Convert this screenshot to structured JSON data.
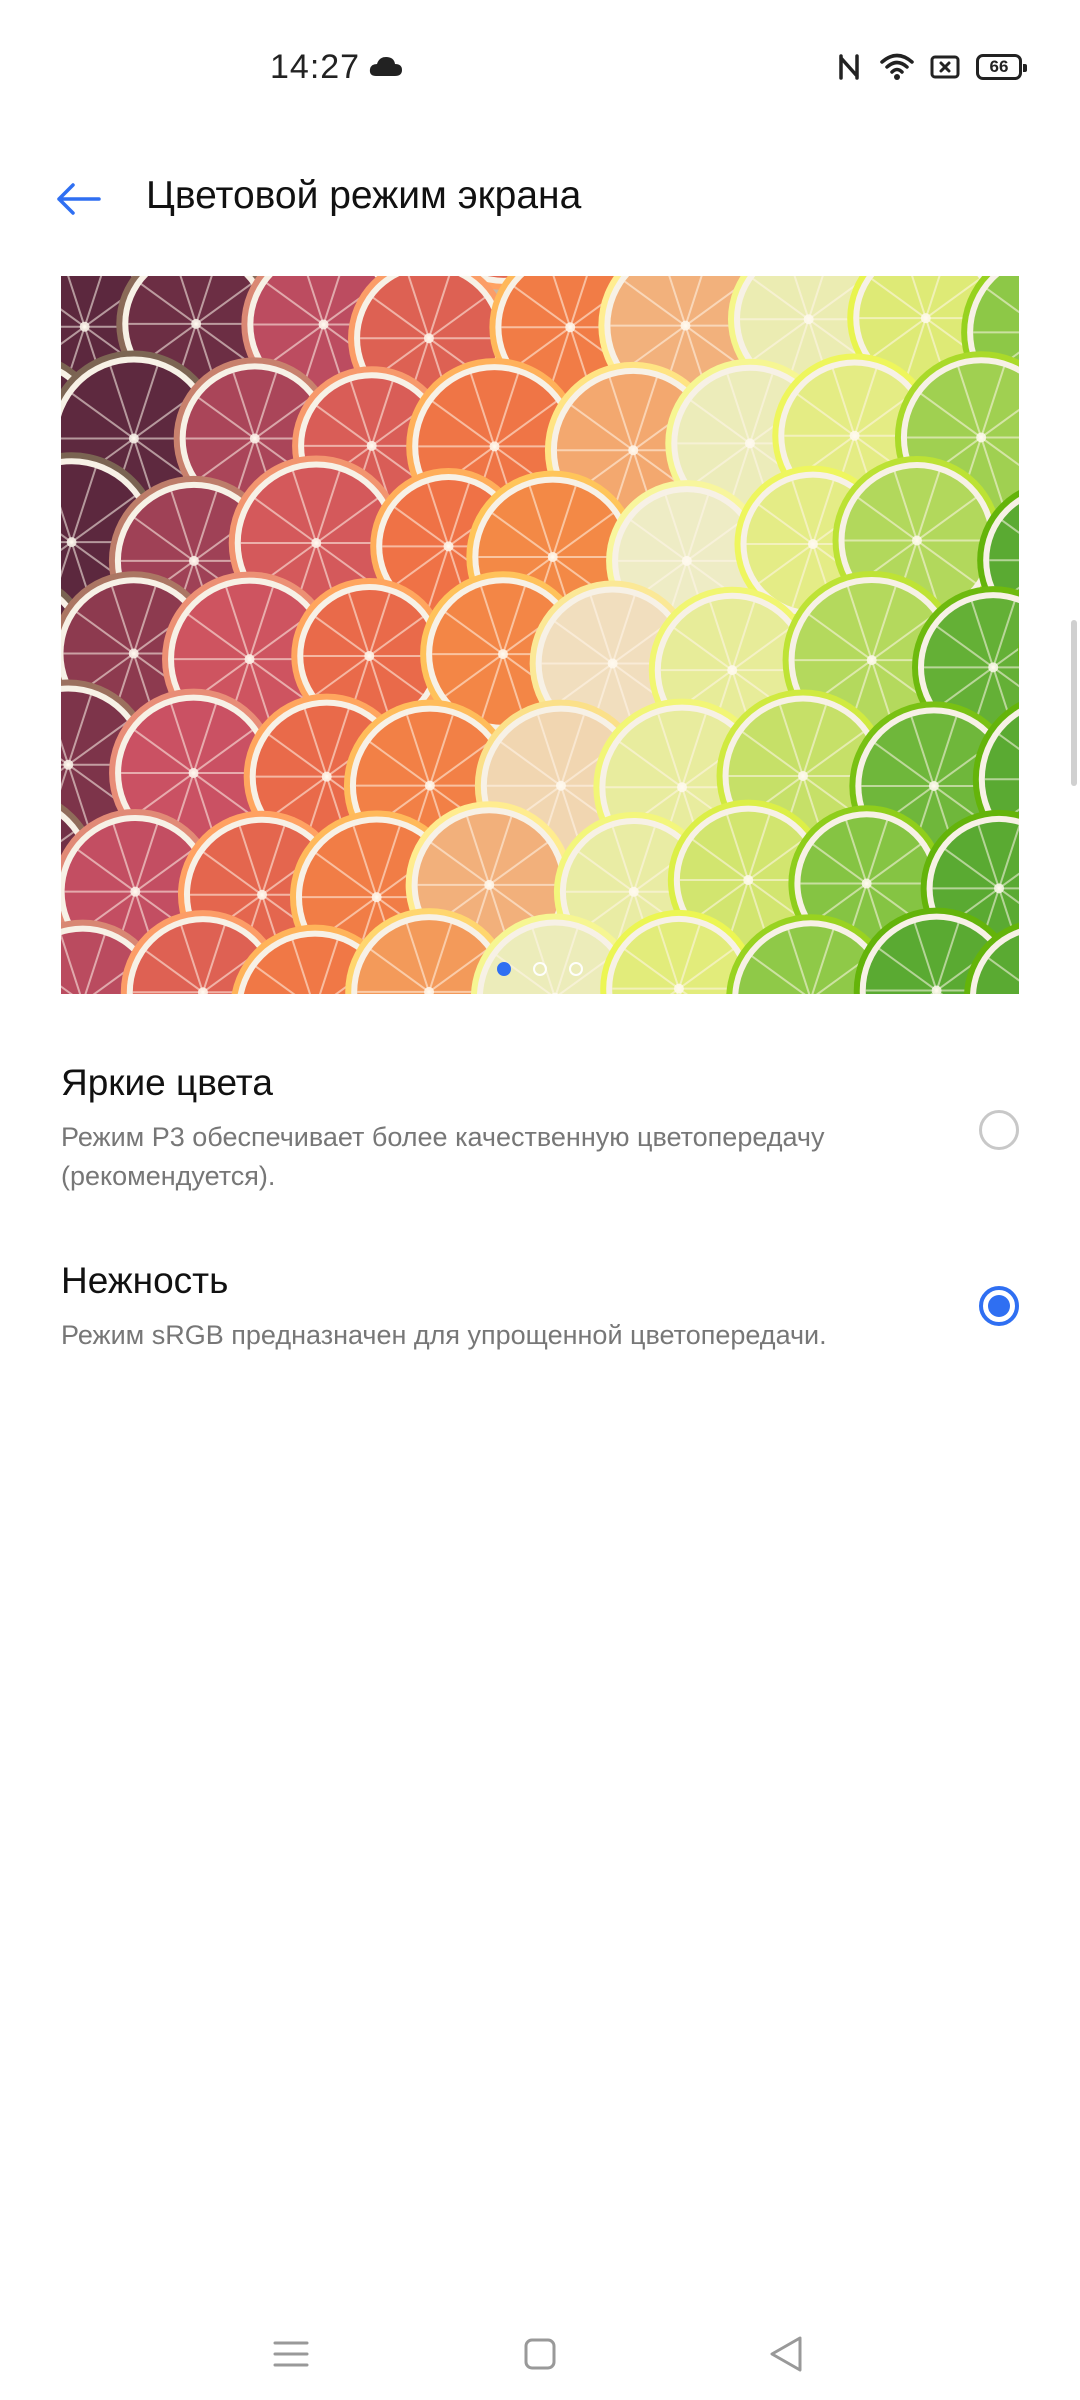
{
  "status_bar": {
    "time": "14:27",
    "icons": [
      "cloud-icon",
      "nfc-icon",
      "wifi-icon",
      "sim-icon",
      "battery-icon"
    ],
    "battery_level": "66"
  },
  "header": {
    "back_icon": "arrow-left-icon",
    "title": "Цветовой режим экрана"
  },
  "preview": {
    "description_icon": "citrus-slices-image",
    "pages": 3,
    "active_page": 1
  },
  "options": [
    {
      "title": "Яркие цвета",
      "description": "Режим P3 обеспечивает более качественную цветопередачу (рекомендуется).",
      "selected": false
    },
    {
      "title": "Нежность",
      "description": "Режим sRGB предназначен для упрощенной цветопередачи.",
      "selected": true
    }
  ],
  "navigation": {
    "items": [
      "menu-icon",
      "home-icon",
      "back-triangle-icon"
    ]
  },
  "colors": {
    "accent": "#2f6ff2",
    "text_primary": "#111111",
    "text_secondary": "#777777",
    "radio_border": "#c8c8c8"
  }
}
